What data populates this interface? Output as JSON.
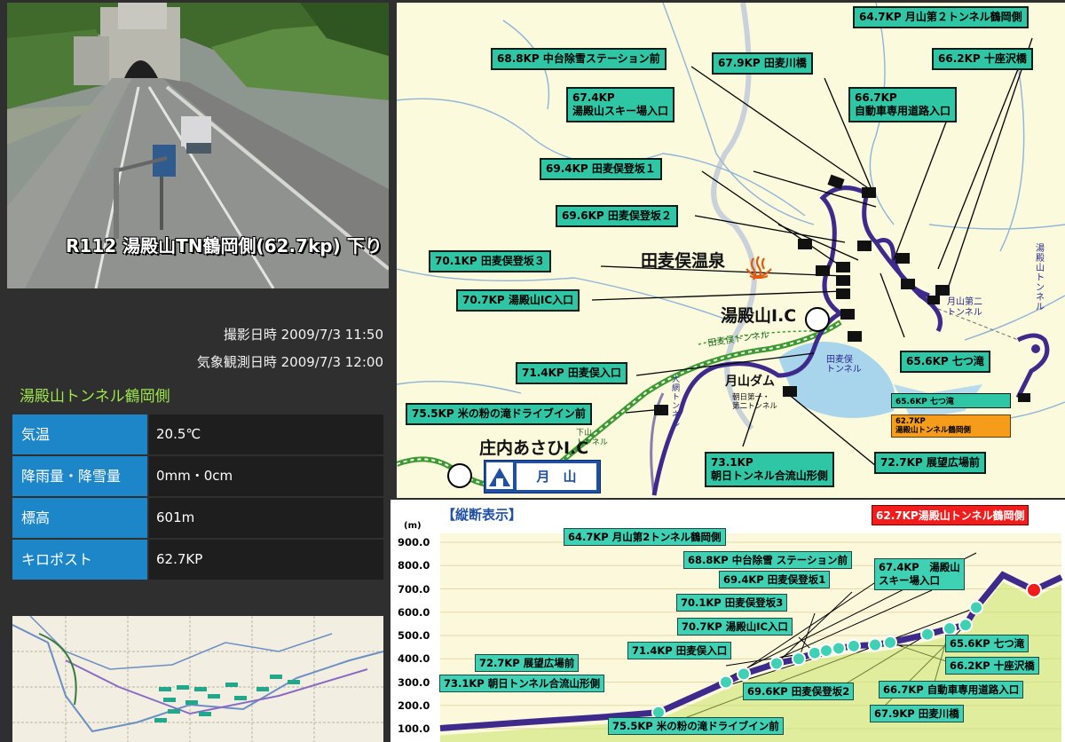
{
  "camera": {
    "caption": "R112 湯殿山TN鶴岡側(62.7kp) 下り"
  },
  "meta": {
    "shot_time_label": "撮影日時",
    "shot_time": "2009/7/3 11:50",
    "weather_time_label": "気象観測日時",
    "weather_time": "2009/7/3 12:00"
  },
  "site_name": "湯殿山トンネル鶴岡側",
  "weather": [
    {
      "label": "気温",
      "value": "20.5℃"
    },
    {
      "label": "降雨量・降雪量",
      "value": "0mm・0cm"
    },
    {
      "label": "標高",
      "value": "601m"
    },
    {
      "label": "キロポスト",
      "value": "62.7KP"
    }
  ],
  "map": {
    "places": {
      "onsen": "田麦俣温泉",
      "yudonosan_ic": "湯殿山I.C",
      "gassan_dam": "月山ダム",
      "shonai_ic": "庄内あさひI.C",
      "gassan_sign": "月　山",
      "tamugimata_tunnel": "田麦俣トンネル",
      "tamugimata_tunnel2": "田麦俣\nトンネル",
      "gassan2_tunnel": "月山第二\nトンネル",
      "yudono_tunnel": "湯殿山\nトンネル",
      "asahi_tunnel": "朝日第一・\n第二トンネル",
      "osawa_tunnel": "大網\nトンネル",
      "shimoyama_tunnel": "下山\nトンネル"
    },
    "callouts": {
      "c1": "64.7KP 月山第２トンネル鶴岡側",
      "c2": "68.8KP 中台除雪ステーション前",
      "c3": "67.9KP 田麦川橋",
      "c4": "66.2KP 十座沢橋",
      "c5a": "67.4KP",
      "c5b": "湯殿山スキー場入口",
      "c6a": "66.7KP",
      "c6b": "自動車専用道路入口",
      "c7": "69.4KP 田麦俣登坂１",
      "c8": "69.6KP 田麦俣登坂２",
      "c9": "70.1KP 田麦俣登坂３",
      "c10": "70.7KP 湯殿山IC入口",
      "c11": "71.4KP 田麦俣入口",
      "c12": "65.6KP 七つ滝",
      "c13": "75.5KP 米の粉の滝ドライブイン前",
      "c14a": "73.1KP",
      "c14b": "朝日トンネル合流山形側",
      "c15": "72.7KP 展望広場前"
    },
    "legend": {
      "small": "65.6KP 七つ滝",
      "sel_a": "62.7KP",
      "sel_b": "湯殿山トンネル鶴岡側"
    }
  },
  "profile": {
    "title": "【縦断表示】",
    "unit": "(m)",
    "selected": "62.7KP湯殿山トンネル鶴岡側",
    "labels": {
      "p1": "64.7KP 月山第2トンネル鶴岡側",
      "p2": "68.8KP 中台除雪 ステーション前",
      "p3a": "67.4KP　湯殿山",
      "p3b": "スキー場入口",
      "p4": "69.4KP 田麦俣登坂1",
      "p5": "70.1KP 田麦俣登坂3",
      "p6": "70.7KP 湯殿山IC入口",
      "p7": "71.4KP 田麦俣入口",
      "p8": "72.7KP 展望広場前",
      "p9": "73.1KP 朝日トンネル合流山形側",
      "p10": "65.6KP 七つ滝",
      "p11": "66.2KP 十座沢橋",
      "p12": "69.6KP 田麦俣登坂2",
      "p13": "66.7KP 自動車専用道路入口",
      "p14": "67.9KP 田麦川橋",
      "p15": "75.5KP 米の粉の滝ドライブイン前"
    }
  },
  "chart_data": {
    "type": "line",
    "title": "【縦断表示】",
    "ylabel": "(m)",
    "yticks": [
      "900.0",
      "800.0",
      "700.0",
      "600.0",
      "500.0",
      "400.0",
      "300.0",
      "200.0",
      "100.0"
    ],
    "ylim": [
      100,
      900
    ],
    "points": [
      {
        "kp": "75.5KP",
        "elev": 170
      },
      {
        "kp": "73.1KP",
        "elev": 300
      },
      {
        "kp": "72.7KP",
        "elev": 335
      },
      {
        "kp": "71.4KP",
        "elev": 380
      },
      {
        "kp": "70.7KP",
        "elev": 400
      },
      {
        "kp": "70.1KP",
        "elev": 425
      },
      {
        "kp": "69.6KP",
        "elev": 435
      },
      {
        "kp": "69.4KP",
        "elev": 445
      },
      {
        "kp": "68.8KP",
        "elev": 455
      },
      {
        "kp": "67.9KP",
        "elev": 460
      },
      {
        "kp": "67.4KP",
        "elev": 470
      },
      {
        "kp": "66.7KP",
        "elev": 505
      },
      {
        "kp": "66.2KP",
        "elev": 530
      },
      {
        "kp": "65.6KP",
        "elev": 545
      },
      {
        "kp": "64.7KP",
        "elev": 620
      },
      {
        "kp": "62.7KP",
        "elev": 695
      }
    ]
  }
}
